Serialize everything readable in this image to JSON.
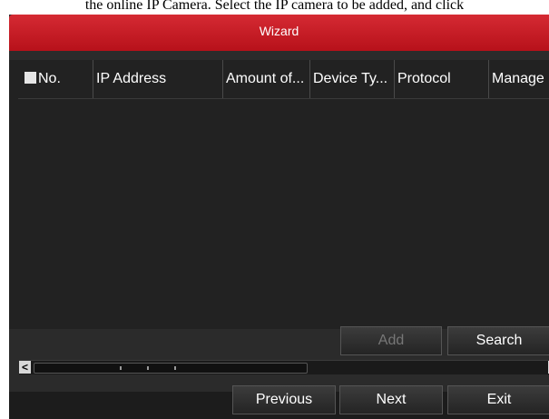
{
  "doc_text": "the online IP Camera. Select the IP camera to be added, and click",
  "dialog": {
    "title": "Wizard"
  },
  "table": {
    "columns": [
      "No.",
      "IP Address",
      "Amount of...",
      "Device Ty...",
      "Protocol",
      "Manage P"
    ],
    "rows": []
  },
  "actions": {
    "add_label": "Add",
    "search_label": "Search"
  },
  "footer": {
    "previous_label": "Previous",
    "next_label": "Next",
    "exit_label": "Exit"
  },
  "colors": {
    "titlebar": "#c41c25",
    "panel": "#2b2b2b",
    "table_bg": "#222222"
  }
}
